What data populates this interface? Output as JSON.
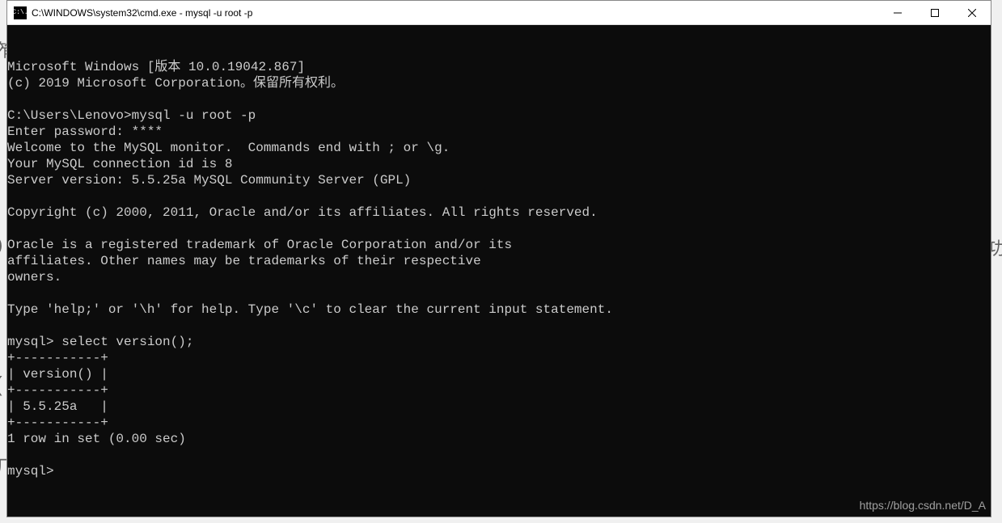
{
  "window": {
    "title": "C:\\WINDOWS\\system32\\cmd.exe - mysql  -u root -p",
    "icon_label": "C:\\."
  },
  "terminal": {
    "lines": [
      "Microsoft Windows [版本 10.0.19042.867]",
      "(c) 2019 Microsoft Corporation。保留所有权利。",
      "",
      "C:\\Users\\Lenovo>mysql -u root -p",
      "Enter password: ****",
      "Welcome to the MySQL monitor.  Commands end with ; or \\g.",
      "Your MySQL connection id is 8",
      "Server version: 5.5.25a MySQL Community Server (GPL)",
      "",
      "Copyright (c) 2000, 2011, Oracle and/or its affiliates. All rights reserved.",
      "",
      "Oracle is a registered trademark of Oracle Corporation and/or its",
      "affiliates. Other names may be trademarks of their respective",
      "owners.",
      "",
      "Type 'help;' or '\\h' for help. Type '\\c' to clear the current input statement.",
      "",
      "mysql> select version();",
      "+-----------+",
      "| version() |",
      "+-----------+",
      "| 5.5.25a   |",
      "+-----------+",
      "1 row in set (0.00 sec)",
      "",
      "mysql>"
    ]
  },
  "watermark": "https://blog.csdn.net/D_A",
  "background_fragments": {
    "left1": "笮",
    "left2": ")",
    "left3": "(",
    "left4": "厂",
    "right1": "功"
  }
}
